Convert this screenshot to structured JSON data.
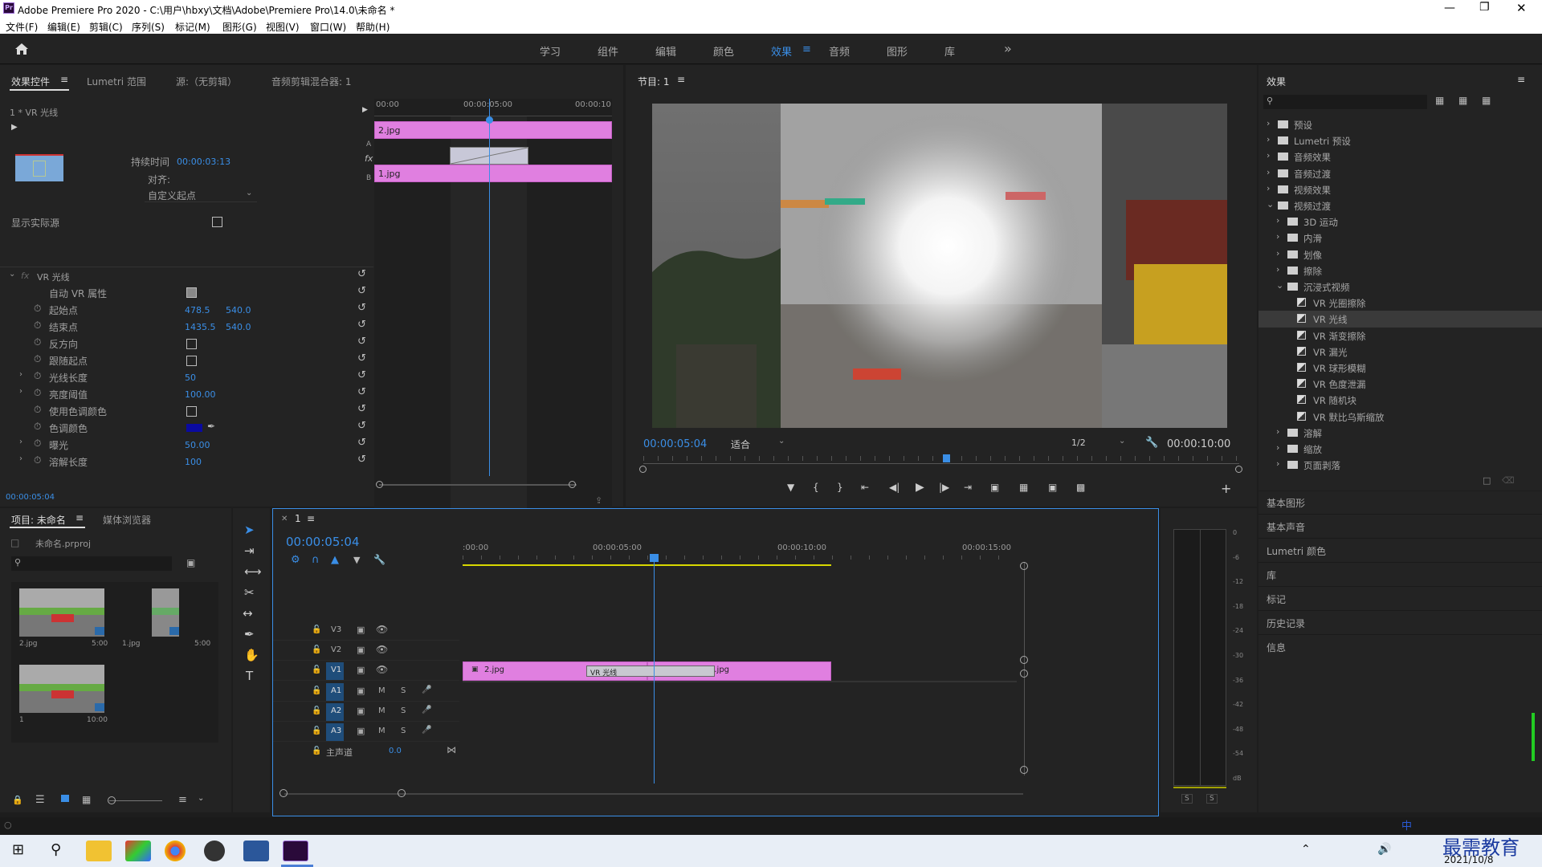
{
  "title": "Adobe Premiere Pro 2020 - C:\\用户\\hbxy\\文档\\Adobe\\Premiere Pro\\14.0\\未命名 *",
  "menu": [
    "文件(F)",
    "编辑(E)",
    "剪辑(C)",
    "序列(S)",
    "标记(M)",
    "图形(G)",
    "视图(V)",
    "窗口(W)",
    "帮助(H)"
  ],
  "workspaces": [
    "学习",
    "组件",
    "编辑",
    "颜色",
    "效果",
    "音频",
    "图形",
    "库"
  ],
  "active_workspace": "效果",
  "effect_controls": {
    "tabs": [
      "效果控件",
      "Lumetri 范围",
      "源:（无剪辑）",
      "音频剪辑混合器: 1"
    ],
    "clip_label": "1 * VR 光线",
    "duration_label": "持续时间",
    "duration_value": "00:00:03:13",
    "align_label": "对齐:",
    "align_value": "自定义起点",
    "show_source": "显示实际源",
    "effect_name": "VR 光线",
    "ruler": [
      "00:00",
      "00:00:05:00",
      "00:00:10"
    ],
    "clip_a": "2.jpg",
    "clip_b": "1.jpg",
    "fx": "fx",
    "props": [
      {
        "label": "自动 VR 属性",
        "v1": "",
        "v2": ""
      },
      {
        "label": "起始点",
        "v1": "478.5",
        "v2": "540.0"
      },
      {
        "label": "结束点",
        "v1": "1435.5",
        "v2": "540.0"
      },
      {
        "label": "反方向",
        "v1": "",
        "v2": ""
      },
      {
        "label": "跟随起点",
        "v1": "",
        "v2": ""
      },
      {
        "label": "光线长度",
        "v1": "50",
        "v2": ""
      },
      {
        "label": "亮度阈值",
        "v1": "100.00",
        "v2": ""
      },
      {
        "label": "使用色调颜色",
        "v1": "",
        "v2": ""
      },
      {
        "label": "色调颜色",
        "v1": "",
        "v2": ""
      },
      {
        "label": "曝光",
        "v1": "50.00",
        "v2": ""
      },
      {
        "label": "溶解长度",
        "v1": "100",
        "v2": ""
      }
    ],
    "timecode": "00:00:05:04",
    "tint_color": "#0a0aa0"
  },
  "program": {
    "title": "节目: 1",
    "timecode": "00:00:05:04",
    "fit": "适合",
    "resolution": "1/2",
    "duration": "00:00:10:00",
    "playhead_fraction": 0.508
  },
  "effects": {
    "title": "效果",
    "tree": [
      {
        "label": "预设",
        "level": 0,
        "type": "folder",
        "open": false
      },
      {
        "label": "Lumetri 预设",
        "level": 0,
        "type": "folder",
        "open": false
      },
      {
        "label": "音频效果",
        "level": 0,
        "type": "folder",
        "open": false
      },
      {
        "label": "音频过渡",
        "level": 0,
        "type": "folder",
        "open": false
      },
      {
        "label": "视频效果",
        "level": 0,
        "type": "folder",
        "open": false
      },
      {
        "label": "视频过渡",
        "level": 0,
        "type": "folder",
        "open": true
      },
      {
        "label": "3D 运动",
        "level": 1,
        "type": "folder",
        "open": false
      },
      {
        "label": "内滑",
        "level": 1,
        "type": "folder",
        "open": false
      },
      {
        "label": "划像",
        "level": 1,
        "type": "folder",
        "open": false
      },
      {
        "label": "擦除",
        "level": 1,
        "type": "folder",
        "open": false
      },
      {
        "label": "沉浸式视频",
        "level": 1,
        "type": "folder",
        "open": true
      },
      {
        "label": "VR 光圈擦除",
        "level": 2,
        "type": "item",
        "open": false
      },
      {
        "label": "VR 光线",
        "level": 2,
        "type": "item",
        "open": false,
        "selected": true
      },
      {
        "label": "VR 渐变擦除",
        "level": 2,
        "type": "item",
        "open": false
      },
      {
        "label": "VR 漏光",
        "level": 2,
        "type": "item",
        "open": false
      },
      {
        "label": "VR 球形模糊",
        "level": 2,
        "type": "item",
        "open": false
      },
      {
        "label": "VR 色度泄漏",
        "level": 2,
        "type": "item",
        "open": false
      },
      {
        "label": "VR 随机块",
        "level": 2,
        "type": "item",
        "open": false
      },
      {
        "label": "VR 默比乌斯缩放",
        "level": 2,
        "type": "item",
        "open": false
      },
      {
        "label": "溶解",
        "level": 1,
        "type": "folder",
        "open": false
      },
      {
        "label": "缩放",
        "level": 1,
        "type": "folder",
        "open": false
      },
      {
        "label": "页面剥落",
        "level": 1,
        "type": "folder",
        "open": false
      }
    ],
    "side_panels": [
      "基本图形",
      "基本声音",
      "Lumetri 颜色",
      "库",
      "标记",
      "历史记录",
      "信息"
    ]
  },
  "project": {
    "tabs": [
      "项目: 未命名",
      "媒体浏览器"
    ],
    "file": "未命名.prproj",
    "items": [
      {
        "name": "2.jpg",
        "dur": "5:00"
      },
      {
        "name": "1.jpg",
        "dur": "5:00"
      },
      {
        "name": "1",
        "dur": "10:00"
      }
    ]
  },
  "timeline": {
    "tab": "1",
    "timecode": "00:00:05:04",
    "ruler": [
      ":00:00",
      "00:00:05:00",
      "00:00:10:00",
      "00:00:15:00"
    ],
    "video_tracks": [
      "V3",
      "V2",
      "V1"
    ],
    "audio_tracks": [
      "A1",
      "A2",
      "A3"
    ],
    "master": "主声道",
    "master_val": "0.0",
    "clips": [
      {
        "label": "2.jpg"
      },
      {
        "label": "1.jpg"
      }
    ],
    "transition": "VR 光线",
    "mute": "M",
    "solo": "S"
  },
  "meter": {
    "ticks": [
      "0",
      "-6",
      "-12",
      "-18",
      "-24",
      "-30",
      "-36",
      "-42",
      "-48",
      "-54",
      "dB"
    ],
    "solo": [
      "S",
      "S"
    ]
  },
  "taskbar": {
    "date": "2021/10/8",
    "watermark": "最需教育",
    "ime": "中"
  }
}
